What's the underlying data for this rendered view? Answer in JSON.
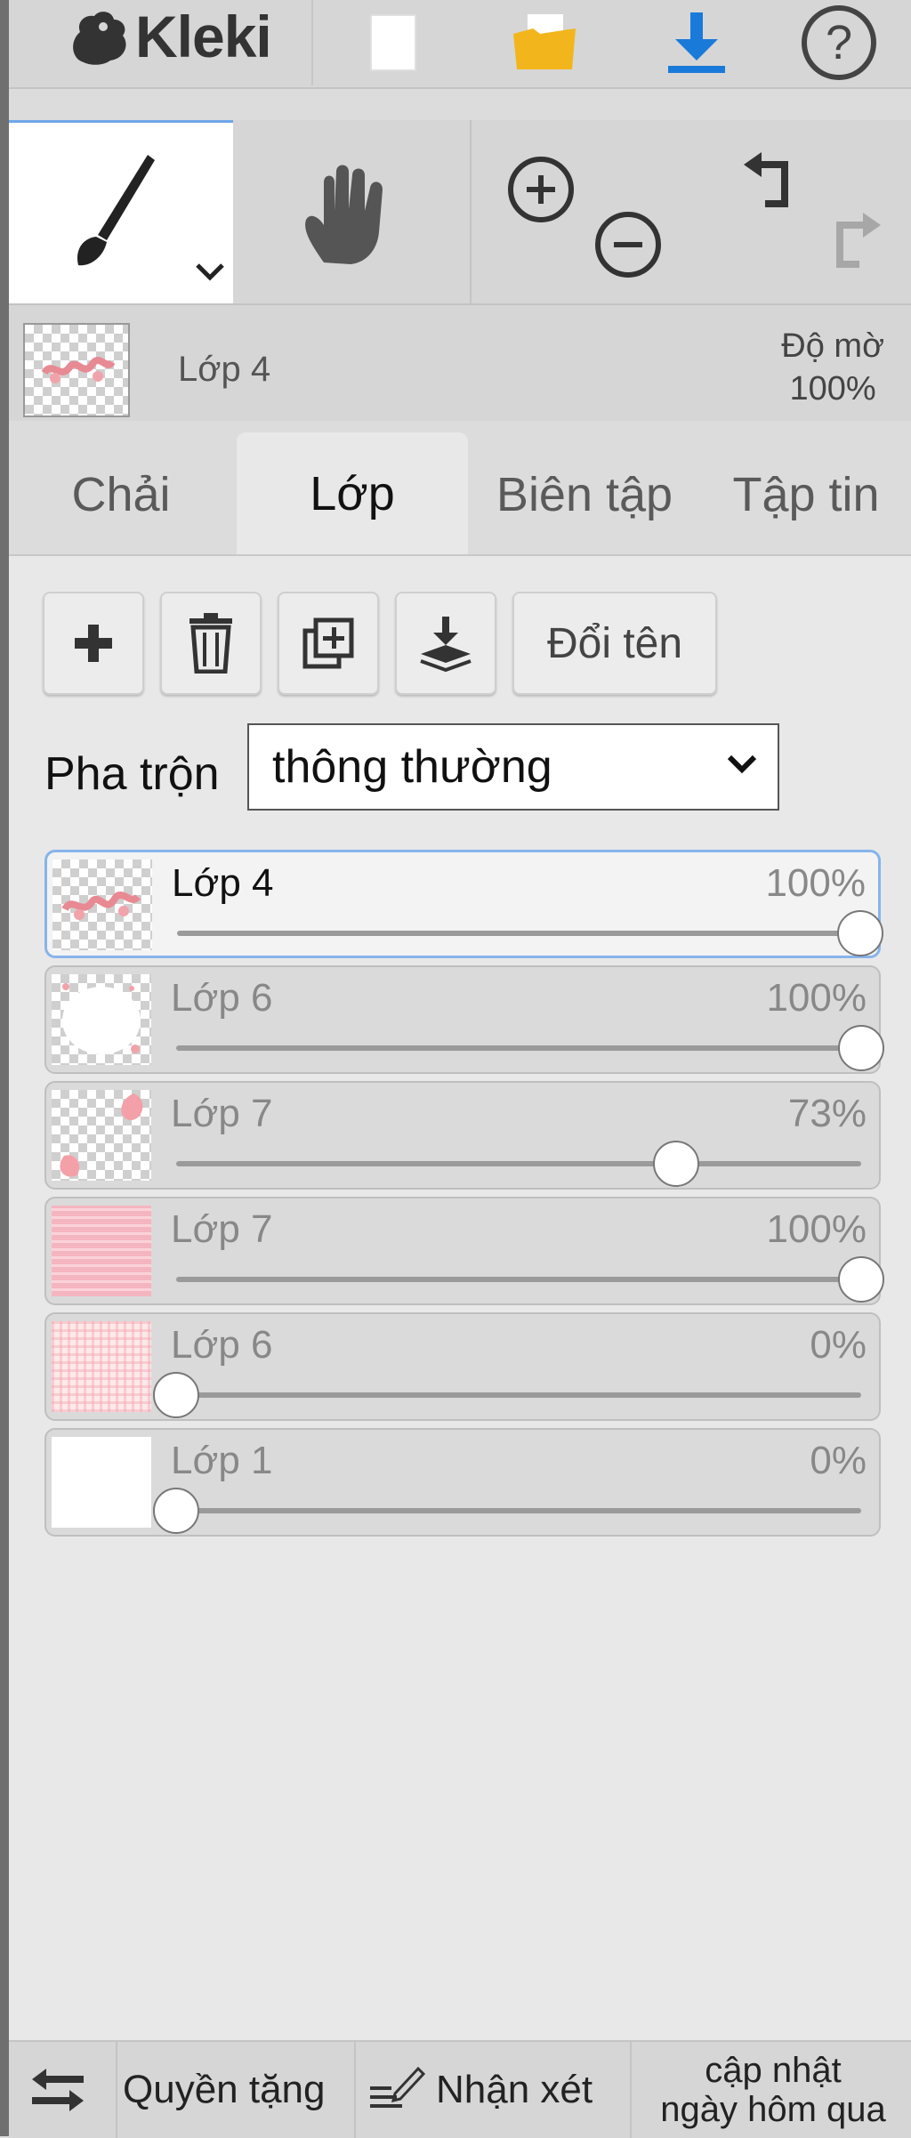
{
  "app": {
    "title": "Kleki"
  },
  "preview": {
    "layer_name": "Lớp 4",
    "opacity_label": "Độ mờ",
    "opacity_value": "100%"
  },
  "tabs": [
    {
      "label": "Chải",
      "active": false
    },
    {
      "label": "Lớp",
      "active": true
    },
    {
      "label": "Biên tập",
      "active": false
    },
    {
      "label": "Tập tin",
      "active": false
    }
  ],
  "layer_actions": {
    "rename_label": "Đổi tên"
  },
  "blend": {
    "label": "Pha trộn",
    "value": "thông thường"
  },
  "layers": [
    {
      "name": "Lớp 4",
      "opacity": "100%",
      "opacity_fraction": 1.0,
      "selected": true
    },
    {
      "name": "Lớp 6",
      "opacity": "100%",
      "opacity_fraction": 1.0,
      "selected": false
    },
    {
      "name": "Lớp 7",
      "opacity": "73%",
      "opacity_fraction": 0.73,
      "selected": false
    },
    {
      "name": "Lớp 7",
      "opacity": "100%",
      "opacity_fraction": 1.0,
      "selected": false
    },
    {
      "name": "Lớp 6",
      "opacity": "0%",
      "opacity_fraction": 0.0,
      "selected": false
    },
    {
      "name": "Lớp 1",
      "opacity": "0%",
      "opacity_fraction": 0.0,
      "selected": false
    }
  ],
  "footer": {
    "permissions_label": "Quyền tặng",
    "feedback_label": "Nhận xét",
    "update_line1": "cập nhật",
    "update_line2": "ngày hôm qua"
  },
  "colors": {
    "accent": "#1a7ad9",
    "selection_border": "#86b4ec",
    "folder": "#f2b51c"
  }
}
